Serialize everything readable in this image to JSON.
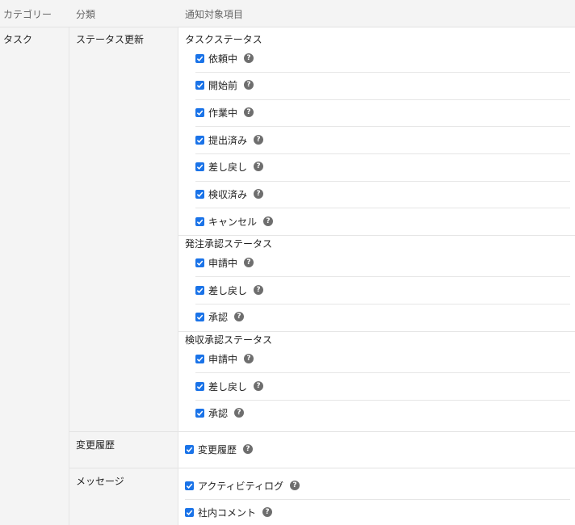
{
  "header": {
    "category": "カテゴリー",
    "classification": "分類",
    "target_items": "通知対象項目"
  },
  "category": "タスク",
  "subcategories": {
    "status_update": "ステータス更新",
    "change_history": "変更履歴",
    "message": "メッセージ"
  },
  "groups": {
    "task_status": {
      "title": "タスクステータス",
      "items": [
        "依頼中",
        "開始前",
        "作業中",
        "提出済み",
        "差し戻し",
        "検収済み",
        "キャンセル"
      ]
    },
    "order_approval": {
      "title": "発注承認ステータス",
      "items": [
        "申請中",
        "差し戻し",
        "承認"
      ]
    },
    "acceptance_approval": {
      "title": "検収承認ステータス",
      "items": [
        "申請中",
        "差し戻し",
        "承認"
      ]
    },
    "change_history": {
      "items": [
        "変更履歴"
      ]
    },
    "message": {
      "items": [
        "アクティビティログ",
        "社内コメント"
      ]
    }
  },
  "help_glyph": "?",
  "icons": {
    "checkbox": "checkbox-checked-icon",
    "help": "question-circle-icon"
  },
  "colors": {
    "checkbox": "#1a73e8",
    "help_icon": "#6e6e6e",
    "header_bg": "#f4f4f4"
  }
}
